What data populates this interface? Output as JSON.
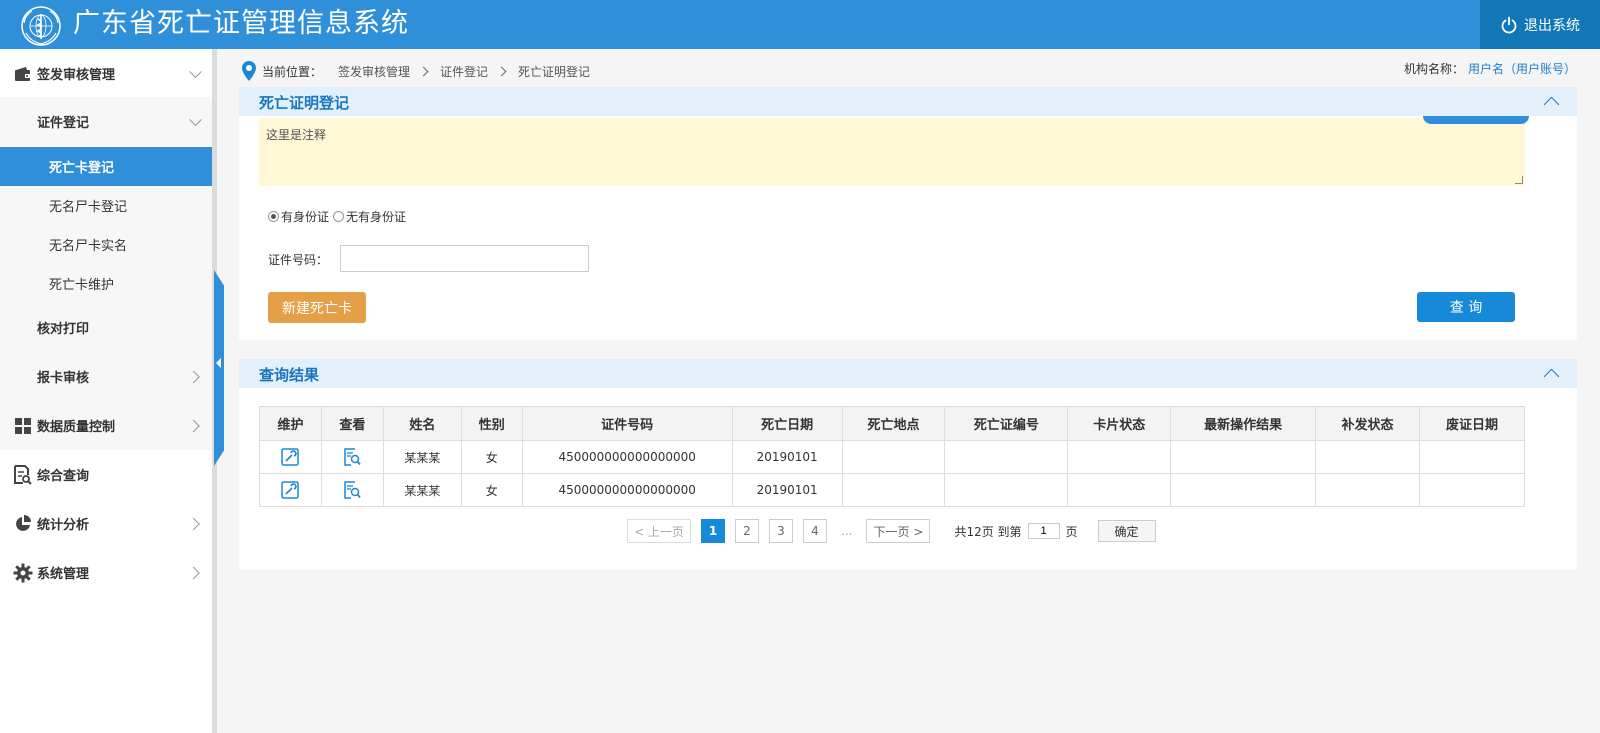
{
  "header": {
    "title": "广东省死亡证管理信息系统",
    "logout_label": "退出系统"
  },
  "sidebar": {
    "groups": [
      {
        "label": "签发审核管理",
        "icon": "wallet-icon",
        "expanded": true
      },
      {
        "label": "数据质量控制",
        "icon": "grid-icon",
        "expanded": false
      },
      {
        "label": "综合查询",
        "icon": "document-search-icon",
        "expanded": false
      },
      {
        "label": "统计分析",
        "icon": "pie-chart-icon",
        "expanded": false
      },
      {
        "label": "系统管理",
        "icon": "gear-icon",
        "expanded": false
      }
    ],
    "sub": {
      "zhengjian": "证件登记",
      "items": [
        "死亡卡登记",
        "无名尸卡登记",
        "无名尸卡实名",
        "死亡卡维护"
      ],
      "hedui": "核对打印",
      "baoka": "报卡审核"
    },
    "active_item": "死亡卡登记"
  },
  "breadcrumb": {
    "prefix": "当前位置：",
    "crumbs": [
      "签发审核管理",
      "证件登记",
      "死亡证明登记"
    ]
  },
  "org": {
    "label": "机构名称：",
    "user": "用户名（用户账号）"
  },
  "register_panel": {
    "title": "死亡证明登记",
    "note": "这里是注释",
    "radio_options": [
      {
        "label": "有身份证",
        "checked": true
      },
      {
        "label": "无有身份证",
        "checked": false
      }
    ],
    "id_label": "证件号码：",
    "id_value": "",
    "new_button": "新建死亡卡",
    "query_button": "查 询"
  },
  "results_panel": {
    "title": "查询结果",
    "columns": [
      "维护",
      "查看",
      "姓名",
      "性别",
      "证件号码",
      "死亡日期",
      "死亡地点",
      "死亡证编号",
      "卡片状态",
      "最新操作结果",
      "补发状态",
      "废证日期"
    ],
    "rows": [
      {
        "name": "某某某",
        "gender": "女",
        "id_no": "450000000000000000",
        "death_date": "20190101",
        "place": "",
        "cert_no": "",
        "card_status": "",
        "latest_result": "",
        "reissue": "",
        "void_date": ""
      },
      {
        "name": "某某某",
        "gender": "女",
        "id_no": "450000000000000000",
        "death_date": "20190101",
        "place": "",
        "cert_no": "",
        "card_status": "",
        "latest_result": "",
        "reissue": "",
        "void_date": ""
      }
    ]
  },
  "pager": {
    "prev": "< 上一页",
    "pages": [
      "1",
      "2",
      "3",
      "4"
    ],
    "current": "1",
    "ellipsis": "...",
    "next": "下一页 >",
    "total_text": "共12页 到第",
    "goto_value": "1",
    "page_unit": "页",
    "confirm": "确定"
  },
  "colors": {
    "primary": "#2f8fd8",
    "header_dark": "#1277b7",
    "accent_orange": "#e59f46",
    "note_bg": "#fff7d6",
    "panel_head": "#e1f0fb"
  }
}
